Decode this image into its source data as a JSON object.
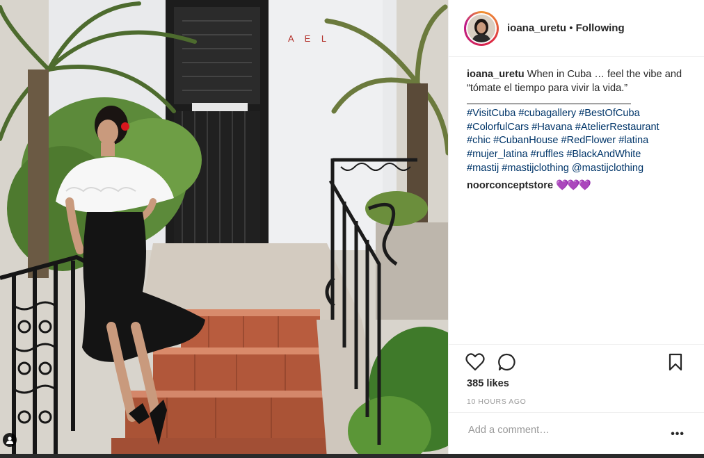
{
  "post": {
    "username": "ioana_uretu",
    "separator": "•",
    "follow_status": "Following",
    "caption_user": "ioana_uretu",
    "caption_text": "When in Cuba … feel the vibe and “tómate el tiempo para vivir la vida.”",
    "hashtags_line1": "#VisitCuba #cubagallery #BestOfCuba",
    "hashtags_line2": "#ColorfulCars #Havana #AtelierRestaurant",
    "hashtags_line3": "#chic #CubanHouse #RedFlower #latina",
    "hashtags_line4": "#mujer_latina #ruffles #BlackAndWhite",
    "hashtags_line5": "#mastij #mastijclothing @mastijclothing",
    "comment_user": "noorconceptstore",
    "comment_text": "💜💜💜",
    "likes": "385 likes",
    "time": "10 HOURS AGO",
    "comment_placeholder": "Add a comment…",
    "more_label": "•••",
    "wall_sign": "A E L"
  },
  "icons": {
    "like": "heart-icon",
    "comment": "comment-icon",
    "save": "bookmark-icon",
    "tag": "user-tag-icon"
  },
  "colors": {
    "link": "#003569",
    "text": "#262626",
    "muted": "#999999",
    "border": "#efefef"
  }
}
